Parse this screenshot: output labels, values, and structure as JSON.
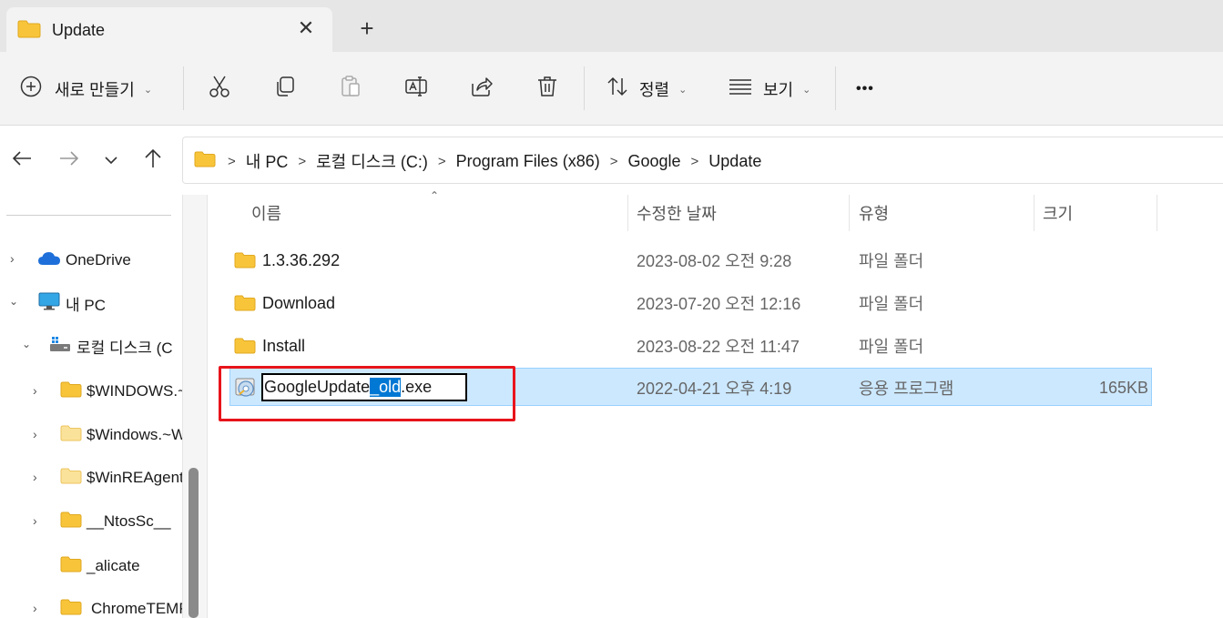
{
  "tab": {
    "title": "Update",
    "close_glyph": "✕",
    "new_glyph": "+"
  },
  "toolbar": {
    "new_label": "새로 만들기",
    "sort_label": "정렬",
    "view_label": "보기",
    "more_label": "•••",
    "icons": [
      "cut-icon",
      "copy-icon",
      "paste-icon",
      "rename-icon",
      "share-icon",
      "delete-icon"
    ]
  },
  "nav": {
    "breadcrumbs": [
      "내 PC",
      "로컬 디스크 (C:)",
      "Program Files (x86)",
      "Google",
      "Update"
    ],
    "crumb_sep": ">"
  },
  "sidebar": {
    "items": [
      {
        "label": "OneDrive"
      },
      {
        "label": "내 PC"
      },
      {
        "label": "로컬 디스크 (C"
      },
      {
        "label": "$WINDOWS.~BT"
      },
      {
        "label": "$Windows.~WS"
      },
      {
        "label": "$WinREAgent"
      },
      {
        "label": "__NtosSc__"
      },
      {
        "label": "_alicate"
      },
      {
        "label": "ChromeTEMP"
      }
    ]
  },
  "columns": {
    "name": "이름",
    "modified": "수정한 날짜",
    "type": "유형",
    "size": "크기"
  },
  "files": [
    {
      "name": "1.3.36.292",
      "modified": "2023-08-02 오전 9:28",
      "type": "파일 폴더",
      "size": ""
    },
    {
      "name": "Download",
      "modified": "2023-07-20 오전 12:16",
      "type": "파일 폴더",
      "size": ""
    },
    {
      "name": "Install",
      "modified": "2023-08-22 오전 11:47",
      "type": "파일 폴더",
      "size": ""
    },
    {
      "name": "GoogleUpdate_old.exe",
      "modified": "2022-04-21 오후 4:19",
      "type": "응용 프로그램",
      "size": "165KB"
    }
  ],
  "rename": {
    "before": "GoogleUpdate",
    "selected": "_old",
    "after": ".exe"
  },
  "colors": {
    "accent": "#0078d4",
    "selection_bg": "#cce8ff",
    "highlight_border": "#e8141b",
    "folder": "#f8c53a"
  }
}
